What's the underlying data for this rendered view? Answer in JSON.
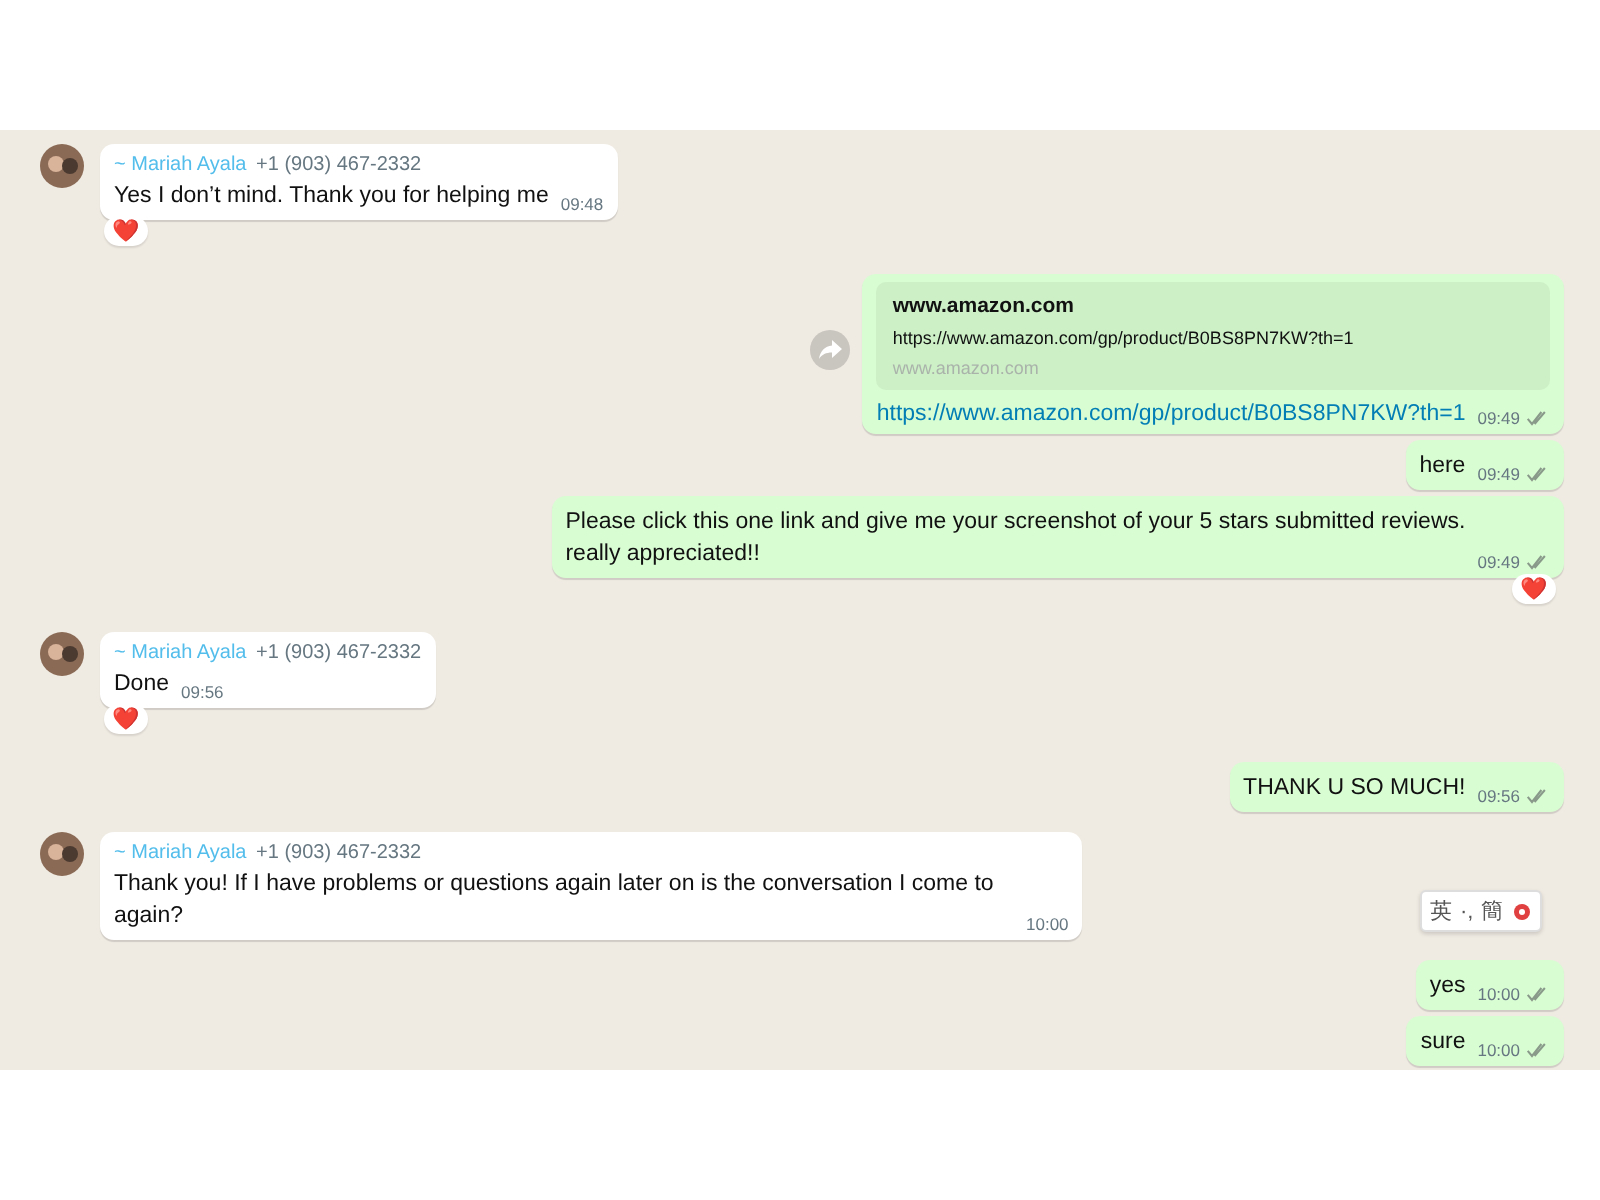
{
  "messages": [
    {
      "kind": "in",
      "sender": "~ Mariah Ayala",
      "phone": "+1 (903) 467-2332",
      "text": "Yes I don’t mind. Thank you for helping me",
      "time": "09:48",
      "reacted": true,
      "reaction": "❤️"
    },
    {
      "kind": "link",
      "title": "www.amazon.com",
      "preview_url": "https://www.amazon.com/gp/product/B0BS8PN7KW?th=1",
      "domain": "www.amazon.com",
      "text": "https://www.amazon.com/gp/product/B0BS8PN7KW?th=1",
      "time": "09:49",
      "reacted": false
    },
    {
      "kind": "out",
      "text": "here",
      "time": "09:49",
      "reacted": false
    },
    {
      "kind": "out",
      "text": "Please click this one link and give me your screenshot of your 5 stars submitted reviews. really appreciated!!",
      "time": "09:49",
      "reacted": true,
      "reaction": "❤️"
    },
    {
      "kind": "in",
      "sender": "~ Mariah Ayala",
      "phone": "+1 (903) 467-2332",
      "text": "Done",
      "time": "09:56",
      "reacted": true,
      "reaction": "❤️"
    },
    {
      "kind": "out",
      "text": "THANK U SO MUCH!",
      "time": "09:56",
      "reacted": false
    },
    {
      "kind": "in",
      "sender": "~ Mariah Ayala",
      "phone": "+1 (903) 467-2332",
      "text": "Thank you! If I have problems or questions again later on is the conversation I come to again?",
      "time": "10:00",
      "reacted": false
    },
    {
      "kind": "out",
      "text": "yes",
      "time": "10:00",
      "reacted": false
    },
    {
      "kind": "out",
      "text": "sure",
      "time": "10:00",
      "reacted": false
    }
  ],
  "ime_toolbar": {
    "language": "英",
    "punctuation": "·,",
    "script": "簡"
  }
}
